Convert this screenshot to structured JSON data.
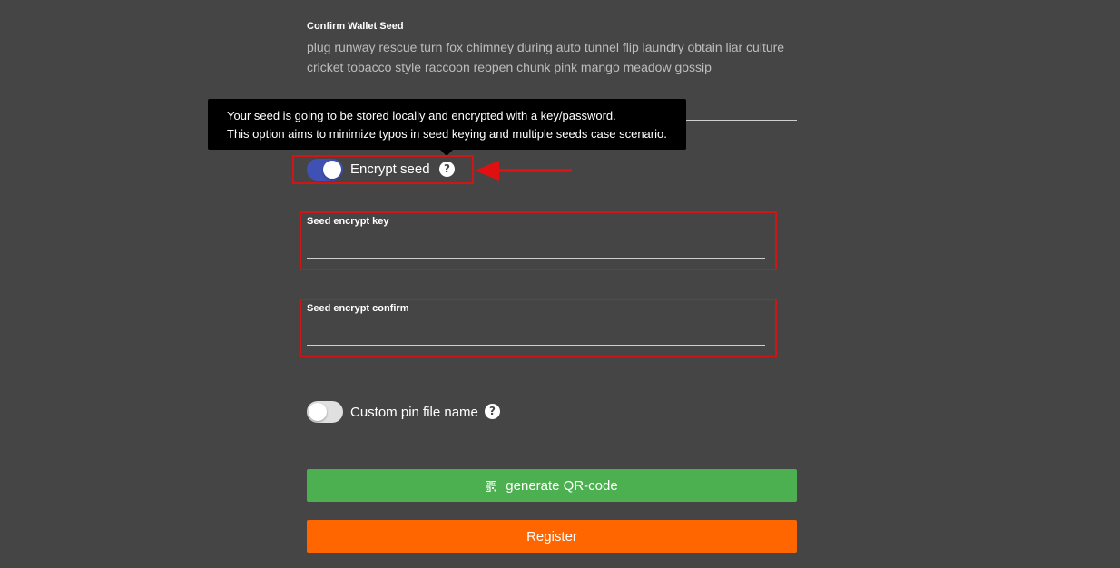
{
  "confirm_seed": {
    "label": "Confirm Wallet Seed",
    "value": "plug runway rescue turn fox chimney during auto tunnel flip laundry obtain liar culture cricket tobacco style raccoon reopen chunk pink mango meadow gossip"
  },
  "tooltip": {
    "line1": "Your seed is going to be stored locally and encrypted with a key/password.",
    "line2": "This option aims to minimize typos in seed keying and multiple seeds case scenario."
  },
  "encrypt_seed": {
    "label": "Encrypt seed",
    "enabled": true,
    "help_icon": "question-circle-icon"
  },
  "seed_encrypt_key": {
    "label": "Seed encrypt key",
    "value": ""
  },
  "seed_encrypt_confirm": {
    "label": "Seed encrypt confirm",
    "value": ""
  },
  "custom_pin": {
    "label": "Custom pin file name",
    "enabled": false,
    "help_icon": "question-circle-icon"
  },
  "buttons": {
    "generate_qr": "generate QR-code",
    "generate_qr_icon": "qr-code-icon",
    "register": "Register"
  },
  "colors": {
    "background": "#454545",
    "toggle_on": "#3f51b5",
    "toggle_off": "#e0e0e0",
    "generate_qr": "#4caf50",
    "register": "#ff6600",
    "highlight": "#d11414"
  }
}
